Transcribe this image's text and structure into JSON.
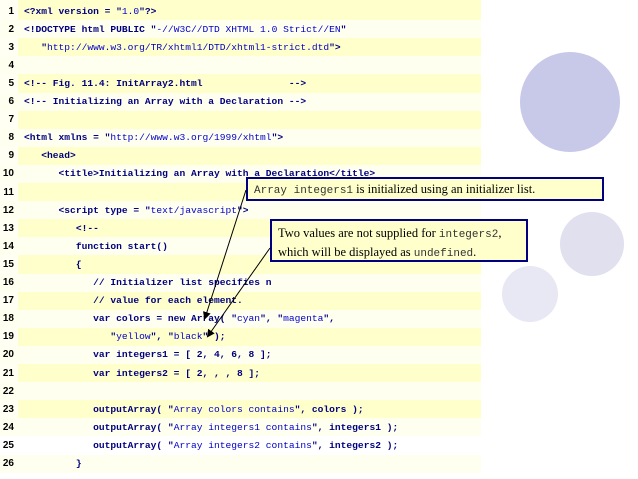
{
  "code_lines": [
    {
      "n": "1",
      "text": "<?xml version = \"1.0\"?>"
    },
    {
      "n": "2",
      "text": "<!DOCTYPE html PUBLIC \"-//W3C//DTD XHTML 1.0 Strict//EN\""
    },
    {
      "n": "3",
      "text": "   \"http://www.w3.org/TR/xhtml1/DTD/xhtml1-strict.dtd\">"
    },
    {
      "n": "4",
      "text": ""
    },
    {
      "n": "5",
      "text": "<!-- Fig. 11.4: InitArray2.html               -->"
    },
    {
      "n": "6",
      "text": "<!-- Initializing an Array with a Declaration -->"
    },
    {
      "n": "7",
      "text": ""
    },
    {
      "n": "8",
      "text": "<html xmlns = \"http://www.w3.org/1999/xhtml\">"
    },
    {
      "n": "9",
      "text": "   <head>"
    },
    {
      "n": "10",
      "text": "      <title>Initializing an Array with a Declaration</title>"
    },
    {
      "n": "11",
      "text": ""
    },
    {
      "n": "12",
      "text": "      <script type = \"text/javascript\">"
    },
    {
      "n": "13",
      "text": "         <!--"
    },
    {
      "n": "14",
      "text": "         function start()"
    },
    {
      "n": "15",
      "text": "         {"
    },
    {
      "n": "16",
      "text": "            // Initializer list specifies n"
    },
    {
      "n": "17",
      "text": "            // value for each element."
    },
    {
      "n": "18",
      "text": "            var colors = new Array( \"cyan\", \"magenta\","
    },
    {
      "n": "19",
      "text": "               \"yellow\", \"black\" );"
    },
    {
      "n": "20",
      "text": "            var integers1 = [ 2, 4, 6, 8 ];"
    },
    {
      "n": "21",
      "text": "            var integers2 = [ 2, , , 8 ];"
    },
    {
      "n": "22",
      "text": ""
    },
    {
      "n": "23",
      "text": "            outputArray( \"Array colors contains\", colors );"
    },
    {
      "n": "24",
      "text": "            outputArray( \"Array integers1 contains\", integers1 );"
    },
    {
      "n": "25",
      "text": "            outputArray( \"Array integers2 contains\", integers2 );"
    },
    {
      "n": "26",
      "text": "         }"
    }
  ],
  "callout1": {
    "code": "Array integers1",
    "text": " is initialized using an initializer list."
  },
  "callout2": {
    "line1": "Two values are not supplied for ",
    "code1": "integers2",
    "tail1": ",",
    "line2": "which will be displayed as ",
    "code2": "undefined",
    "tail2": "."
  },
  "colors": {
    "panel": "#ffffcc",
    "code": "#000080",
    "string": "#0000cc",
    "callout_border": "#000080",
    "circle": "#cfcfe8"
  }
}
